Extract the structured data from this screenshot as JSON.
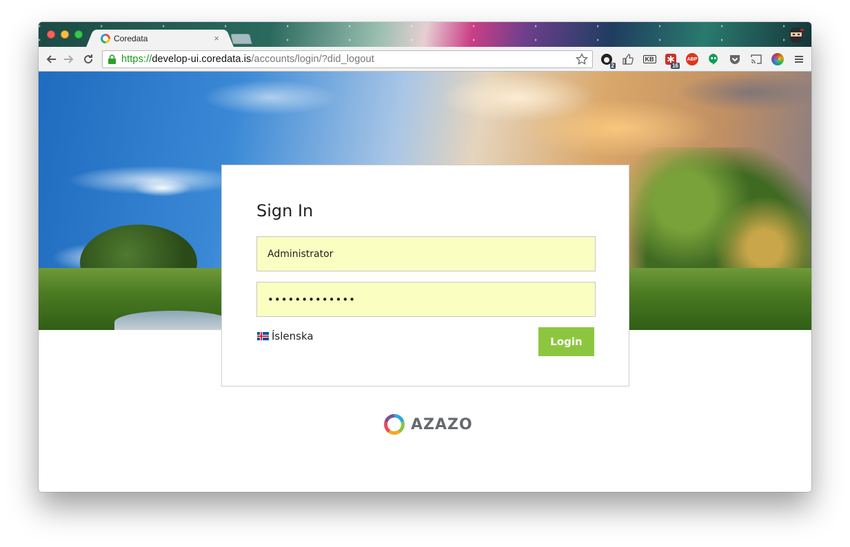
{
  "browser": {
    "tab": {
      "title": "Coredata",
      "close_glyph": "×"
    },
    "address": {
      "scheme": "https://",
      "host": "develop-ui.coredata.is",
      "path": "/accounts/login/?did_logout"
    },
    "extensions": [
      {
        "icon": "github-icon",
        "badge": "2"
      },
      {
        "icon": "thumbs-up-icon"
      },
      {
        "icon": "kb-icon",
        "label": "KB"
      },
      {
        "icon": "lastpass-icon",
        "badge": "16"
      },
      {
        "icon": "adblock-icon",
        "label": "ABP"
      },
      {
        "icon": "hangouts-icon"
      },
      {
        "icon": "pocket-icon"
      },
      {
        "icon": "cast-icon"
      },
      {
        "icon": "color-picker-icon"
      },
      {
        "icon": "menu-icon"
      }
    ]
  },
  "login": {
    "title": "Sign In",
    "username_value": "Administrator",
    "password_value": "•••••••••••••",
    "language_label": "Íslenska",
    "login_button": "Login"
  },
  "footer": {
    "brand": "AZAZO"
  },
  "colors": {
    "accent_green": "#8cc63f",
    "autofill_yellow": "#fafec1",
    "url_scheme_green": "#1a9a1a"
  }
}
